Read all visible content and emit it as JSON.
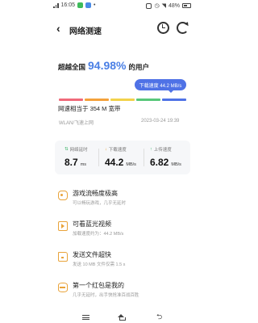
{
  "status_bar": {
    "time": "16:05",
    "battery": "48%",
    "left_icons": [
      "signal-icon",
      "wechat-icon",
      "app-icon"
    ],
    "right_icons": [
      "vibrate-icon",
      "alarm-icon",
      "wifi-icon",
      "battery-icon"
    ]
  },
  "header": {
    "title": "网络测速",
    "back_icon": "chevron-left-icon",
    "history_icon": "history-icon",
    "retest_icon": "refresh-icon"
  },
  "result": {
    "prefix": "超越全国",
    "percent": "94.98%",
    "suffix": "的用户",
    "tooltip": "下载速度 44.2 MB/s",
    "speed_scale_colors": [
      "#f06a7a",
      "#f4a13b",
      "#f2d24b",
      "#58c77a",
      "#4f72e6"
    ],
    "compare_text": "网速相当于 354 M 宽带",
    "network_label": "WLAN/飞速上网",
    "timestamp": "2023-03-24 19:39"
  },
  "stats": [
    {
      "label": "网络延时",
      "value": "8.7",
      "unit": "ms",
      "icon": "latency-icon",
      "color": "#3fb56b"
    },
    {
      "label": "下载速度",
      "value": "44.2",
      "unit": "MB/s",
      "icon": "download-icon",
      "color": "#e9a33a"
    },
    {
      "label": "上传速度",
      "value": "6.82",
      "unit": "MB/s",
      "icon": "upload-icon",
      "color": "#3fb56b"
    }
  ],
  "features": [
    {
      "title": "游戏流畅度极高",
      "desc": "可以畅玩游戏，几乎无延时",
      "icon": "gamepad-icon"
    },
    {
      "title": "可看蓝光视频",
      "desc": "加载速度约为：44.2 MB/s",
      "icon": "video-icon"
    },
    {
      "title": "发送文件超快",
      "desc": "发送 10 MB 文件仅需 1.5 s",
      "icon": "folder-icon"
    },
    {
      "title": "第一个红包是我的",
      "desc": "几乎无延时，出手快抢准百战百胜",
      "icon": "red-packet-icon"
    }
  ],
  "nav_bar": {
    "menu_icon": "menu-icon",
    "home_icon": "home-icon",
    "back_icon": "back-icon"
  },
  "colors": {
    "accent": "#4a7fe5",
    "tooltip": "#4f72e6",
    "feature_icon": "#e9a33a"
  }
}
